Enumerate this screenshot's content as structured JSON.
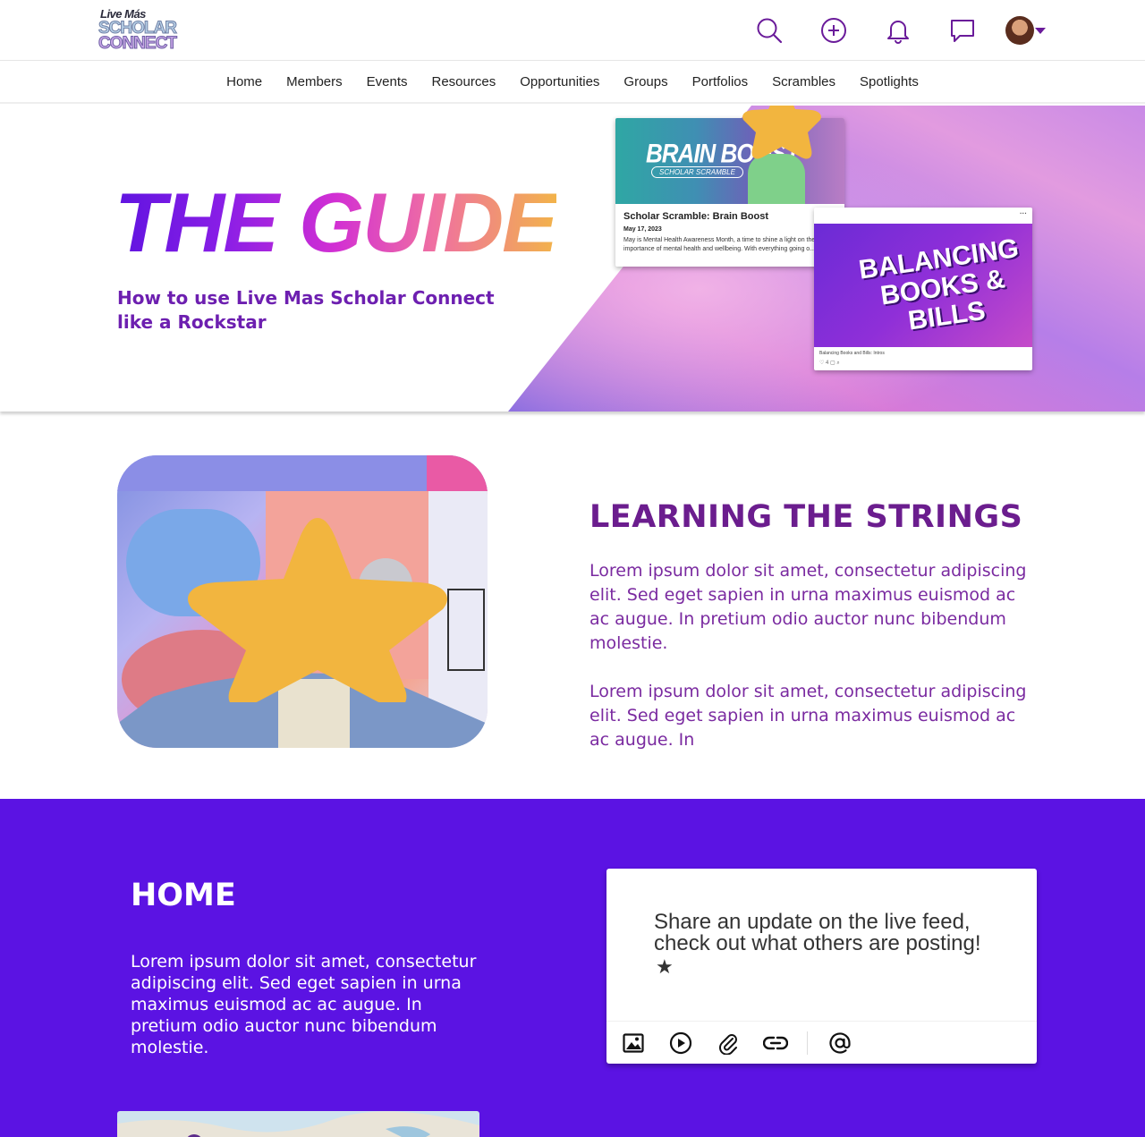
{
  "brand": {
    "line1": "Live Más",
    "line2": "SCHOLAR",
    "line3": "CONNECT"
  },
  "colors": {
    "accent_purple": "#6d1fb0",
    "home_bg": "#5b13e3",
    "icon_purple": "#6a1b9a",
    "star_yellow": "#f2b53f"
  },
  "topbar": {
    "icons": [
      "search-icon",
      "plus-circle-icon",
      "bell-icon",
      "chat-icon"
    ],
    "profile_caret": "caret-down-icon"
  },
  "nav": {
    "items": [
      "Home",
      "Members",
      "Events",
      "Resources",
      "Opportunities",
      "Groups",
      "Portfolios",
      "Scrambles",
      "Spotlights"
    ]
  },
  "hero": {
    "title": "THE GUIDE",
    "subtitle": "How to use Live Mas Scholar Connect like a Rockstar",
    "card1": {
      "image_title": "BRAIN BOOST",
      "image_tag": "SCHOLAR SCRAMBLE",
      "title": "Scholar Scramble: Brain Boost",
      "date": "May 17, 2023",
      "excerpt": "May is Mental Health Awareness Month, a time to shine a light on the importance of mental health and wellbeing. With everything going o..."
    },
    "card2": {
      "image_title": "BALANCING BOOKS & BILLS",
      "caption": "Balancing Books and Bills: Intros",
      "meta": "♡ 4  ▢  ⌕",
      "menu": "···"
    }
  },
  "learning": {
    "title": "LEARNING THE STRINGS",
    "paragraph1": "Lorem ipsum dolor sit amet, consectetur adipiscing elit. Sed eget sapien in urna maximus euismod ac ac augue. In pretium odio auctor nunc bibendum molestie.",
    "paragraph2": "Lorem ipsum dolor sit amet, consectetur adipiscing elit. Sed eget sapien in urna maximus euismod ac ac augue. In"
  },
  "home": {
    "title": "HOME",
    "paragraph": "Lorem ipsum dolor sit amet, consectetur adipiscing elit. Sed eget sapien in urna maximus euismod ac ac augue. In pretium odio auctor nunc bibendum molestie.",
    "post": {
      "text": "Share an update on the live feed, check out what others are posting!",
      "star": "★",
      "tools": [
        "image-icon",
        "video-play-icon",
        "paperclip-icon",
        "link-icon",
        "mention-icon"
      ]
    }
  }
}
